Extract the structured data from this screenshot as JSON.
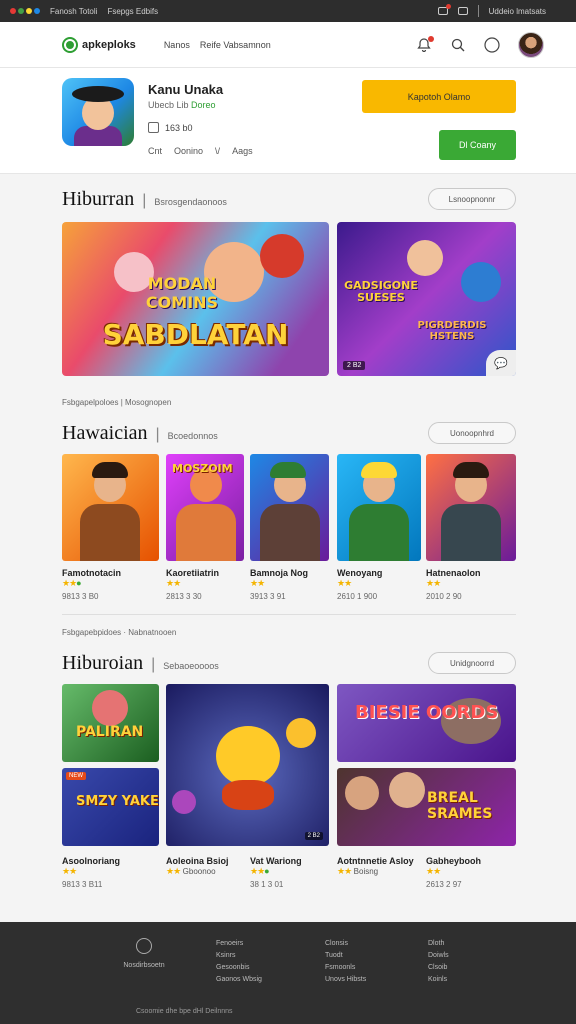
{
  "statusbar": {
    "dot_colors": [
      "#e53935",
      "#43a047",
      "#fdd835",
      "#1e88e5"
    ],
    "left1": "Fanosh Totoli",
    "left2": "Fsepgs Edbifs",
    "right": "Uddeio lmatsats"
  },
  "header": {
    "logo": "apkeploks",
    "nav": [
      "Nanos",
      "Reife Vabsamnon"
    ],
    "icons": [
      "notification-icon",
      "search-icon",
      "profile-circle-icon",
      "avatar"
    ]
  },
  "app": {
    "name": "Kanu Unaka",
    "developer": "Ubecb Lib",
    "developer_highlight": "Doreo",
    "meta": "163 b0",
    "actions": [
      "Cnt",
      "Oonino",
      "\\/",
      "Aags"
    ],
    "primary_button": "Kapotoh Olamo",
    "secondary_button": "Dl Coany"
  },
  "section1": {
    "title": "Hiburran",
    "subtitle": "Bsrosgendaonoos",
    "pill": "Lsnoopnonnr",
    "banner1_text": "SABDLATAN",
    "banner1_sub": "MODAN COMINS",
    "banner2_text": "GADSIGONE SUESES",
    "banner2_sub": "PIGRDERDIS HSTENS",
    "banner2_tag": "2 B2"
  },
  "crumb1": "Fsbgapelpoloes | Mosognopen",
  "section2": {
    "title": "Hawaician",
    "subtitle": "Bcoedonnos",
    "pill": "Uonoopnhrd",
    "games": [
      {
        "name": "Famotnotacin",
        "size": "9813 3 B0"
      },
      {
        "name": "Kaoretiiatrin",
        "size": "2813 3 30"
      },
      {
        "name": "Bamnoja Nog",
        "size": "3913 3 91"
      },
      {
        "name": "Wenoyang",
        "size": "2610 1 900"
      },
      {
        "name": "Hatnenaolon",
        "size": "2010 2 90"
      }
    ],
    "tile_label": "MOSZOIM"
  },
  "crumb2": "Fsbgapebpidoes · Nabnatnooen",
  "section3": {
    "title": "Hiburoian",
    "subtitle": "Sebaoeoooos",
    "pill": "Unidgnoorrd",
    "tiles": [
      "PALIRAN",
      "SMZY YAKE",
      "BIESIE OORDS",
      "BREAL SRAMES"
    ],
    "games": [
      {
        "name": "Asoolnoriang",
        "size": "9813 3 B11",
        "sub": ""
      },
      {
        "name": "Aoleoina Bsioj",
        "size": "",
        "sub": "Gboonoo"
      },
      {
        "name": "Vat Wariong",
        "size": "",
        "sub": "38 1 3 01"
      },
      {
        "name": "Aotntnnetie Asloy",
        "size": "",
        "sub": "Boisng"
      },
      {
        "name": "Gabheybooh",
        "size": "",
        "sub": "2613 2 97"
      }
    ]
  },
  "footer": {
    "brand": "Nosdirbsoetn",
    "col1": [
      "Fenoeirs",
      "Ksinrs",
      "Gesoonbis",
      "Gaonos Wbsig"
    ],
    "col2": [
      "Clonsis",
      "Tuodt",
      "Fsmoonls",
      "Unovs Hibsts"
    ],
    "col3": [
      "Dloth",
      "Doiwls",
      "Clsoib",
      "Koinls"
    ],
    "copyright": "Csoomie dhe bpe dHl Deilnnns"
  }
}
